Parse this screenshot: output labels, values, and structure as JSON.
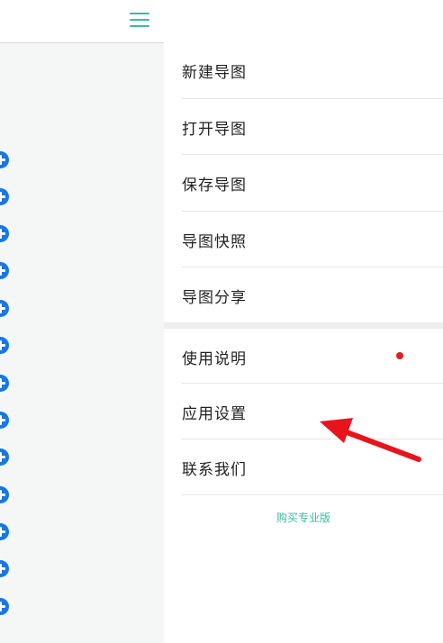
{
  "drawer": {
    "items": [
      {
        "label": "新建导图"
      },
      {
        "label": "打开导图"
      },
      {
        "label": "保存导图"
      },
      {
        "label": "导图快照"
      },
      {
        "label": "导图分享"
      },
      {
        "label": "使用说明"
      },
      {
        "label": "应用设置"
      },
      {
        "label": "联系我们"
      }
    ],
    "buy_label": "购买专业版"
  },
  "icons": {
    "menu": "hamburger-icon",
    "add": "plus-circle-icon",
    "annotation": "red-arrow"
  },
  "colors": {
    "accent": "#3fb8a5",
    "add_button": "#1677e6",
    "notification_dot": "#e02020",
    "annotation_arrow": "#e8141c"
  }
}
